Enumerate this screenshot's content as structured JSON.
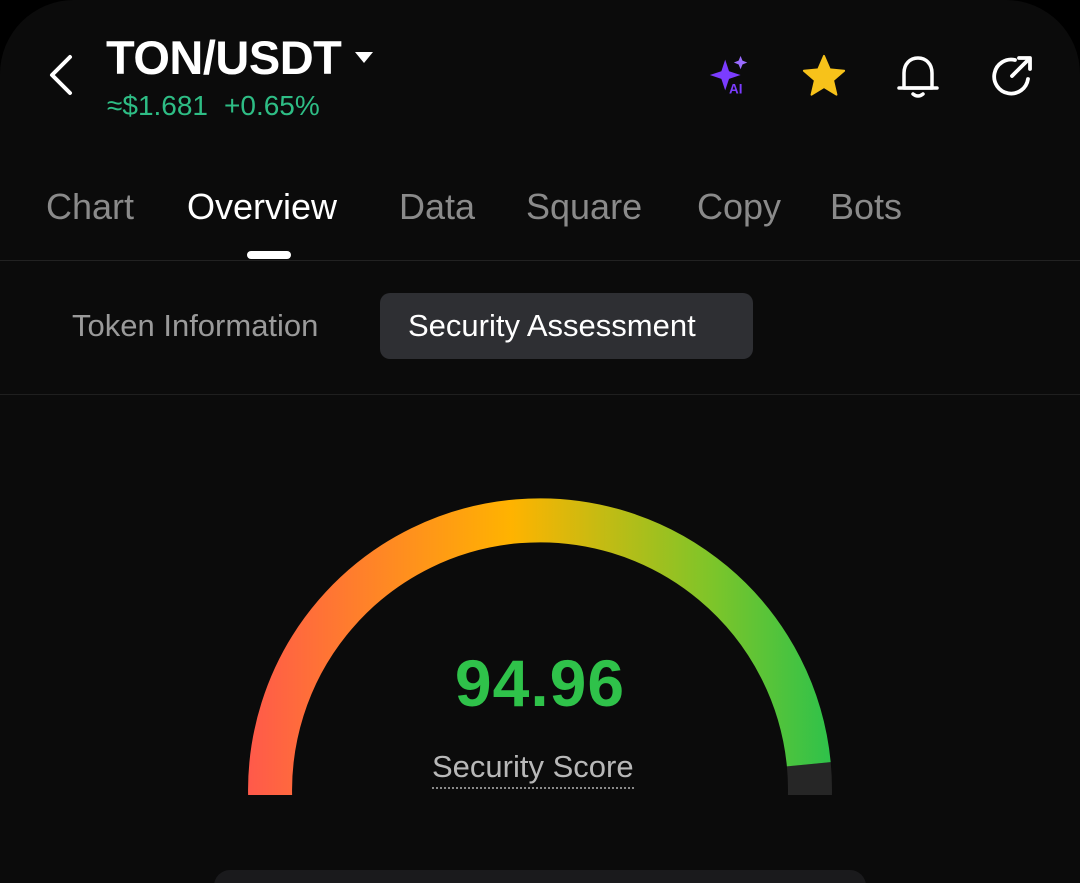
{
  "header": {
    "pair": "TON/USDT",
    "price": "≈$1.681",
    "change": "+0.65%",
    "colors": {
      "positive": "#2ebd85",
      "ai_accent": "#7b3cff",
      "favorite": "#f7c21a"
    },
    "icons": [
      "back-chevron-icon",
      "ai-sparkle-icon",
      "favorite-star-icon",
      "bell-icon",
      "share-icon"
    ],
    "ai_badge": "AI"
  },
  "tabs": [
    {
      "label": "Chart",
      "active": false
    },
    {
      "label": "Overview",
      "active": true
    },
    {
      "label": "Data",
      "active": false
    },
    {
      "label": "Square",
      "active": false
    },
    {
      "label": "Copy",
      "active": false
    },
    {
      "label": "Bots",
      "active": false
    }
  ],
  "subtabs": [
    {
      "label": "Token Information",
      "active": false
    },
    {
      "label": "Security Assessment",
      "active": true
    }
  ],
  "security": {
    "score": "94.96",
    "score_value": 94.96,
    "score_max": 100,
    "label": "Security Score",
    "gauge_colors": [
      "#ff5a4a",
      "#ffb300",
      "#7cc52a",
      "#2fc24a"
    ],
    "score_color": "#2fc24a"
  }
}
